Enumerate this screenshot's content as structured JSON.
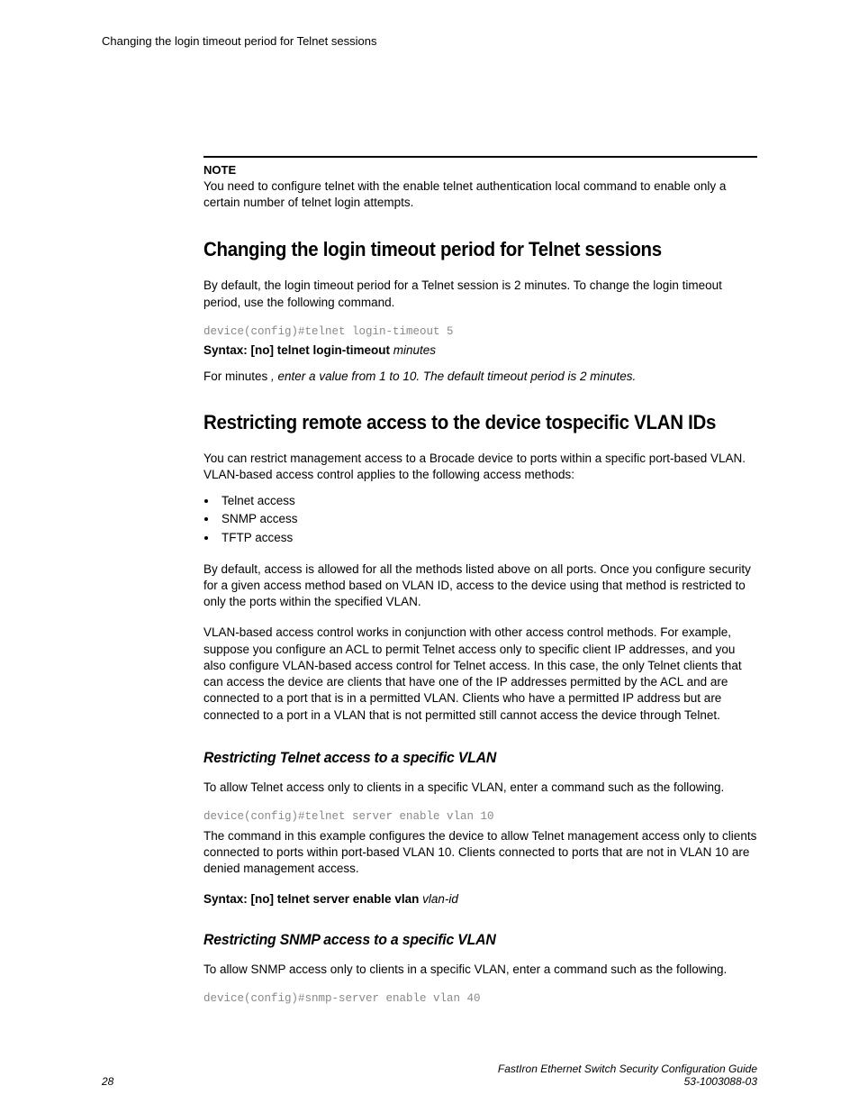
{
  "header": {
    "running": "Changing the login timeout period for Telnet sessions"
  },
  "note": {
    "label": "NOTE",
    "text": "You need to configure telnet with the enable telnet authentication local command to enable only a certain number of telnet login attempts."
  },
  "section1": {
    "title": "Changing the login timeout period for Telnet sessions",
    "intro": "By default, the login timeout period for a Telnet session is 2 minutes. To change the login timeout period, use the following command.",
    "code": "device(config)#telnet login-timeout 5",
    "syntax_bold": "Syntax: [no] telnet login-timeout",
    "syntax_ital": " minutes",
    "desc_roman": "For minutes ",
    "desc_ital": ", enter a value from 1 to 10. The default timeout period is 2 minutes."
  },
  "section2": {
    "title": "Restricting remote access to the device tospecific VLAN IDs",
    "intro": "You can restrict management access to a Brocade device to ports within a specific port-based VLAN. VLAN-based access control applies to the following access methods:",
    "bullets": [
      "Telnet access",
      "SNMP access",
      "TFTP access"
    ],
    "para2": "By default, access is allowed for all the methods listed above on all ports. Once you configure security for a given access method based on VLAN ID, access to the device using that method is restricted to only the ports within the specified VLAN.",
    "para3": "VLAN-based access control works in conjunction with other access control methods. For example, suppose you configure an ACL to permit Telnet access only to specific client IP addresses, and you also configure VLAN-based access control for Telnet access. In this case, the only Telnet clients that can access the device are clients that have one of the IP addresses permitted by the ACL and are connected to a port that is in a permitted VLAN. Clients who have a permitted IP address but are connected to a port in a VLAN that is not permitted still cannot access the device through Telnet."
  },
  "sub1": {
    "title": "Restricting Telnet access to a specific VLAN",
    "intro": "To allow Telnet access only to clients in a specific VLAN, enter a command such as the following.",
    "code": "device(config)#telnet server enable vlan 10",
    "para": "The command in this example configures the device to allow Telnet management access only to clients connected to ports within port-based VLAN 10. Clients connected to ports that are not in VLAN 10 are denied management access.",
    "syntax_bold": "Syntax: [no] telnet server enable vlan",
    "syntax_ital": " vlan-id"
  },
  "sub2": {
    "title": "Restricting SNMP access to a specific VLAN",
    "intro": "To allow SNMP access only to clients in a specific VLAN, enter a command such as the following.",
    "code": "device(config)#snmp-server enable vlan 40"
  },
  "footer": {
    "page": "28",
    "guide": "FastIron Ethernet Switch Security Configuration Guide",
    "docnum": "53-1003088-03"
  }
}
